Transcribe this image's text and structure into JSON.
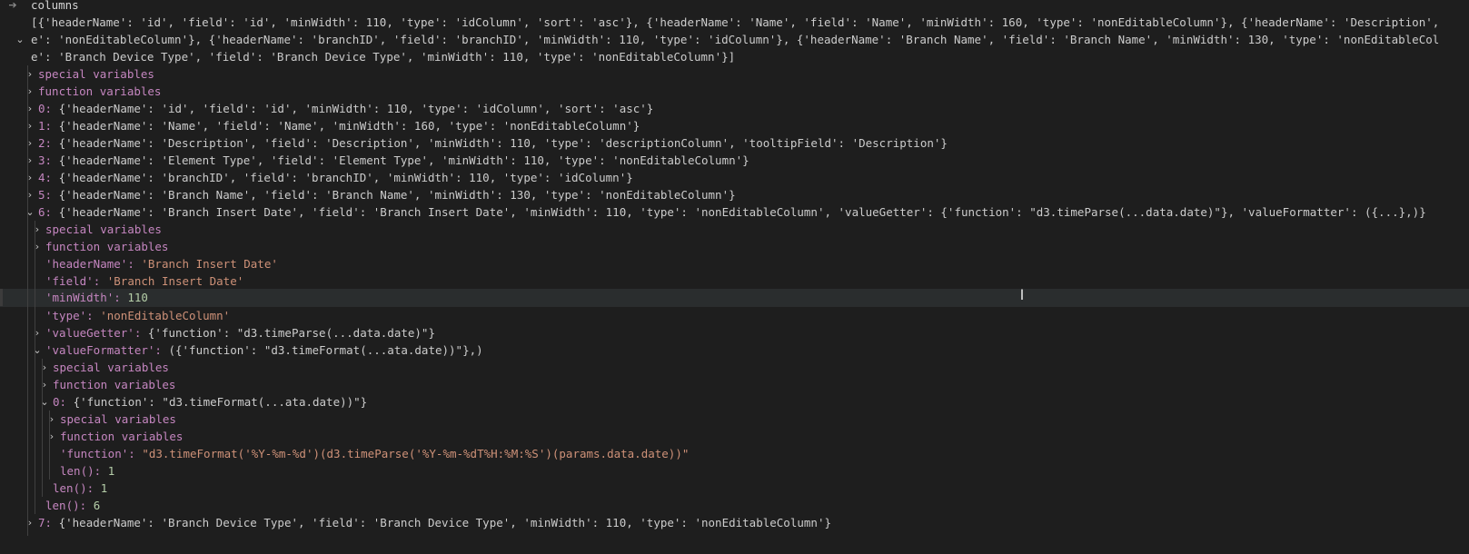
{
  "debug_tree": {
    "root_name": "columns",
    "root_value_line1": "[{'headerName': 'id', 'field': 'id', 'minWidth': 110, 'type': 'idColumn', 'sort': 'asc'}, {'headerName': 'Name', 'field': 'Name', 'minWidth': 160, 'type': 'nonEditableColumn'}, {'headerName': 'Description',",
    "root_value_line2": "e': 'nonEditableColumn'}, {'headerName': 'branchID', 'field': 'branchID', 'minWidth': 110, 'type': 'idColumn'}, {'headerName': 'Branch Name', 'field': 'Branch Name', 'minWidth': 130, 'type': 'nonEditableCol",
    "root_value_line3": "e': 'Branch Device Type', 'field': 'Branch Device Type', 'minWidth': 110, 'type': 'nonEditableColumn'}]",
    "rows": [
      {
        "kind": "group",
        "label": "special variables"
      },
      {
        "kind": "group",
        "label": "function variables"
      },
      {
        "kind": "item",
        "key": "0",
        "value": "{'headerName': 'id', 'field': 'id', 'minWidth': 110, 'type': 'idColumn', 'sort': 'asc'}"
      },
      {
        "kind": "item",
        "key": "1",
        "value": "{'headerName': 'Name', 'field': 'Name', 'minWidth': 160, 'type': 'nonEditableColumn'}"
      },
      {
        "kind": "item",
        "key": "2",
        "value": "{'headerName': 'Description', 'field': 'Description', 'minWidth': 110, 'type': 'descriptionColumn', 'tooltipField': 'Description'}"
      },
      {
        "kind": "item",
        "key": "3",
        "value": "{'headerName': 'Element Type', 'field': 'Element Type', 'minWidth': 110, 'type': 'nonEditableColumn'}"
      },
      {
        "kind": "item",
        "key": "4",
        "value": "{'headerName': 'branchID', 'field': 'branchID', 'minWidth': 110, 'type': 'idColumn'}"
      },
      {
        "kind": "item",
        "key": "5",
        "value": "{'headerName': 'Branch Name', 'field': 'Branch Name', 'minWidth': 130, 'type': 'nonEditableColumn'}"
      },
      {
        "kind": "item",
        "key": "6",
        "value": "{'headerName': 'Branch Insert Date', 'field': 'Branch Insert Date', 'minWidth': 110, 'type': 'nonEditableColumn', 'valueGetter': {'function': \"d3.timeParse(...data.date)\"}, 'valueFormatter': ({...},)}"
      },
      {
        "kind": "group",
        "label": "special variables"
      },
      {
        "kind": "group",
        "label": "function variables"
      },
      {
        "kind": "leaf",
        "key": "'headerName'",
        "value": "'Branch Insert Date'",
        "vtype": "str"
      },
      {
        "kind": "leaf",
        "key": "'field'",
        "value": "'Branch Insert Date'",
        "vtype": "str"
      },
      {
        "kind": "leaf",
        "key": "'minWidth'",
        "value": "110",
        "vtype": "num"
      },
      {
        "kind": "leaf",
        "key": "'type'",
        "value": "'nonEditableColumn'",
        "vtype": "str"
      },
      {
        "kind": "item",
        "key": "'valueGetter'",
        "value": "{'function': \"d3.timeParse(...data.date)\"}"
      },
      {
        "kind": "item",
        "key": "'valueFormatter'",
        "value": "({'function': \"d3.timeFormat(...ata.date))\"},)"
      },
      {
        "kind": "group",
        "label": "special variables"
      },
      {
        "kind": "group",
        "label": "function variables"
      },
      {
        "kind": "item",
        "key": "0",
        "value": "{'function': \"d3.timeFormat(...ata.date))\"}"
      },
      {
        "kind": "group",
        "label": "special variables"
      },
      {
        "kind": "group",
        "label": "function variables"
      },
      {
        "kind": "leaf",
        "key": "'function'",
        "value": "\"d3.timeFormat('%Y-%m-%d')(d3.timeParse('%Y-%m-%dT%H:%M:%S')(params.data.date))\"",
        "vtype": "str"
      },
      {
        "kind": "leaf",
        "key": "len()",
        "value": "1",
        "vtype": "num"
      },
      {
        "kind": "leaf",
        "key": "len()",
        "value": "1",
        "vtype": "num"
      },
      {
        "kind": "leaf",
        "key": "len()",
        "value": "6",
        "vtype": "num"
      },
      {
        "kind": "item",
        "key": "7",
        "value": "{'headerName': 'Branch Device Type', 'field': 'Branch Device Type', 'minWidth': 110, 'type': 'nonEditableColumn'}"
      }
    ]
  },
  "colors": {
    "background": "#1e1e1e",
    "key": "#c586c0",
    "string": "#ce9178",
    "number": "#b5cea8",
    "hover_row": "#2a2d2e"
  }
}
